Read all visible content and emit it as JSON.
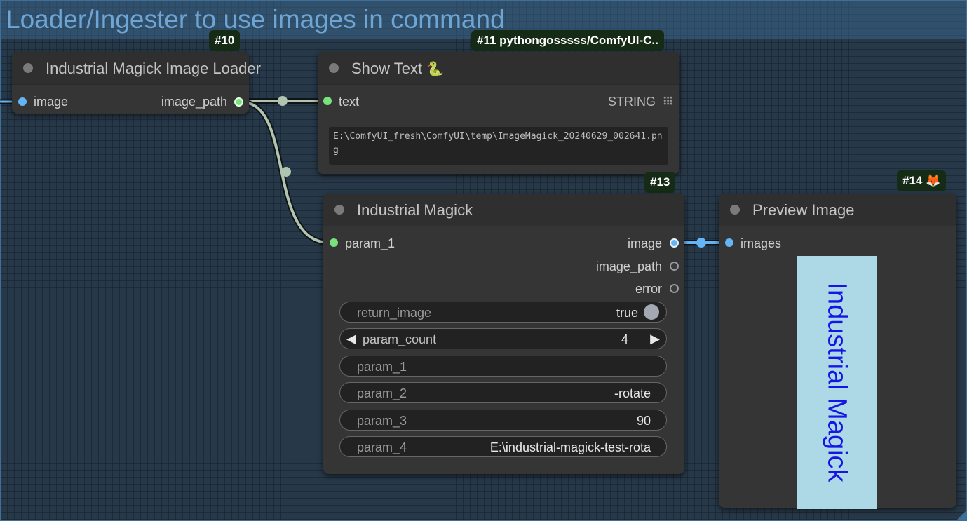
{
  "group": {
    "title": "Loader/Ingester to use images in command"
  },
  "nodes": {
    "loader": {
      "badge": "#10",
      "title": "Industrial Magick Image Loader",
      "input": "image",
      "output": "image_path"
    },
    "show_text": {
      "badge": "#11 pythongosssss/ComfyUI-C..",
      "title": "Show Text",
      "title_icon": "🐍",
      "input": "text",
      "output_type": "STRING",
      "text_value": "E:\\ComfyUI_fresh\\ComfyUI\\temp\\ImageMagick_20240629_002641.png"
    },
    "magick": {
      "badge": "#13",
      "title": "Industrial Magick",
      "input": "param_1",
      "outputs": [
        "image",
        "image_path",
        "error"
      ],
      "widgets": {
        "return_image": {
          "label": "return_image",
          "value": "true"
        },
        "param_count": {
          "label": "param_count",
          "value": "4"
        },
        "param_1": {
          "label": "param_1",
          "value": ""
        },
        "param_2": {
          "label": "param_2",
          "value": "-rotate"
        },
        "param_3": {
          "label": "param_3",
          "value": "90"
        },
        "param_4": {
          "label": "param_4",
          "value": "E:\\industrial-magick-test-rota"
        }
      }
    },
    "preview": {
      "badge": "#14",
      "badge_icon": "🦊",
      "title": "Preview Image",
      "input": "images",
      "image_text": "Industrial Magick"
    }
  },
  "colors": {
    "string_link": "#b0c4b0",
    "image_link": "#64b5f6",
    "badge_bg": "#162b16",
    "preview_bg": "#add8e6",
    "preview_text": "#1515e6"
  }
}
